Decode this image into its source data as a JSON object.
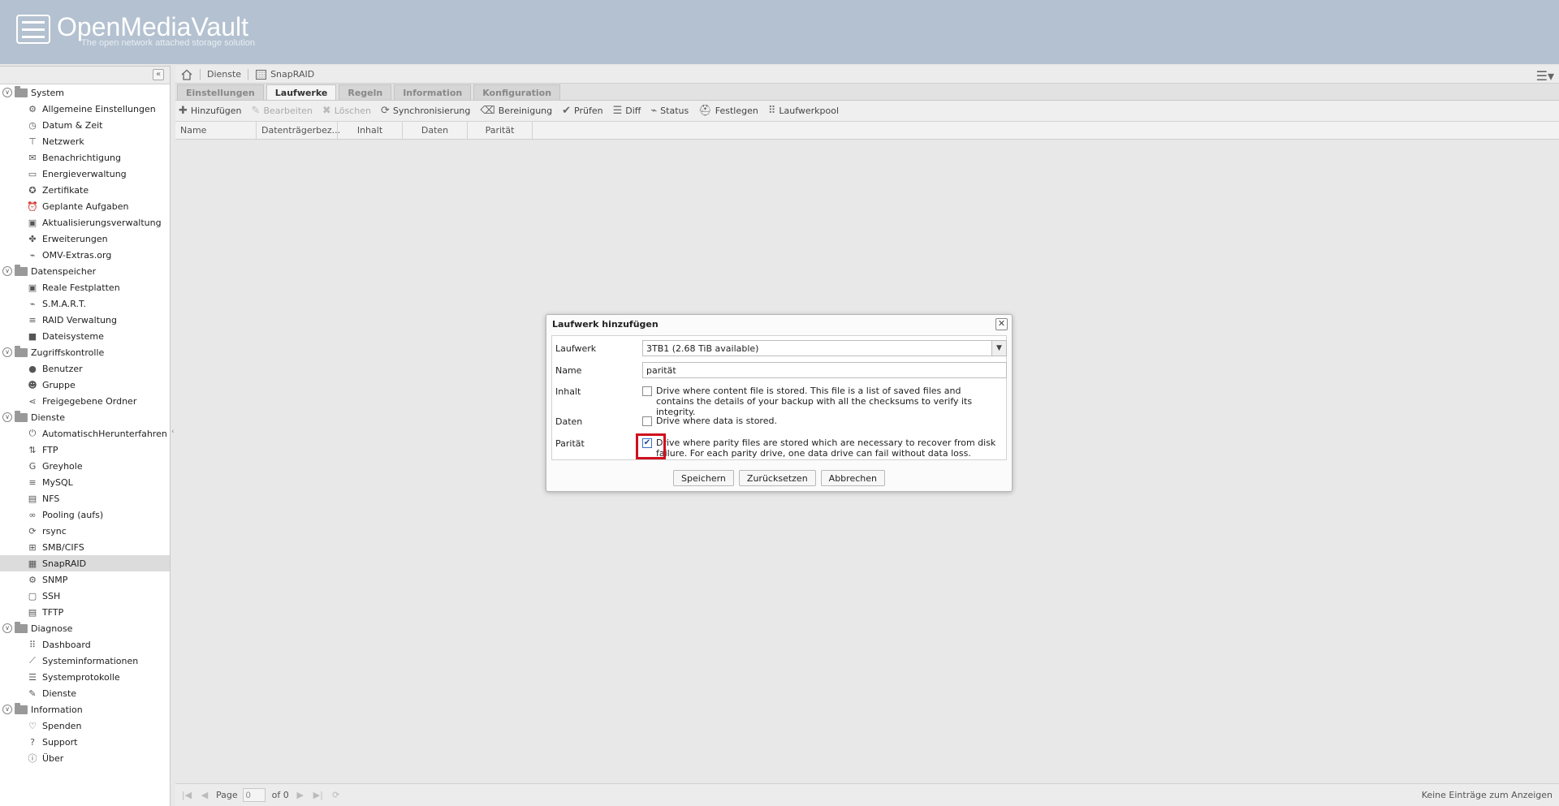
{
  "header": {
    "title": "OpenMediaVault",
    "subtitle": "The open network attached storage solution"
  },
  "sidebar": {
    "collapse_label": "«",
    "tree": [
      {
        "label": "System",
        "type": "group",
        "icon": "folder-icon"
      },
      {
        "label": "Allgemeine Einstellungen",
        "type": "leaf",
        "icon": "gears-icon"
      },
      {
        "label": "Datum & Zeit",
        "type": "leaf",
        "icon": "clock-icon"
      },
      {
        "label": "Netzwerk",
        "type": "leaf",
        "icon": "network-icon"
      },
      {
        "label": "Benachrichtigung",
        "type": "leaf",
        "icon": "envelope-icon"
      },
      {
        "label": "Energieverwaltung",
        "type": "leaf",
        "icon": "battery-icon"
      },
      {
        "label": "Zertifikate",
        "type": "leaf",
        "icon": "certificate-icon"
      },
      {
        "label": "Geplante Aufgaben",
        "type": "leaf",
        "icon": "alarm-clock-icon"
      },
      {
        "label": "Aktualisierungsverwaltung",
        "type": "leaf",
        "icon": "update-icon"
      },
      {
        "label": "Erweiterungen",
        "type": "leaf",
        "icon": "puzzle-icon"
      },
      {
        "label": "OMV-Extras.org",
        "type": "leaf",
        "icon": "plug-icon"
      },
      {
        "label": "Datenspeicher",
        "type": "group",
        "icon": "folder-icon"
      },
      {
        "label": "Reale Festplatten",
        "type": "leaf",
        "icon": "hdd-icon"
      },
      {
        "label": "S.M.A.R.T.",
        "type": "leaf",
        "icon": "pulse-icon"
      },
      {
        "label": "RAID Verwaltung",
        "type": "leaf",
        "icon": "database-icon"
      },
      {
        "label": "Dateisysteme",
        "type": "leaf",
        "icon": "folder-closed-icon"
      },
      {
        "label": "Zugriffskontrolle",
        "type": "group",
        "icon": "folder-icon"
      },
      {
        "label": "Benutzer",
        "type": "leaf",
        "icon": "user-icon"
      },
      {
        "label": "Gruppe",
        "type": "leaf",
        "icon": "users-icon"
      },
      {
        "label": "Freigegebene Ordner",
        "type": "leaf",
        "icon": "share-icon"
      },
      {
        "label": "Dienste",
        "type": "group",
        "icon": "folder-icon"
      },
      {
        "label": "AutomatischHerunterfahren",
        "type": "leaf",
        "icon": "power-icon"
      },
      {
        "label": "FTP",
        "type": "leaf",
        "icon": "ftp-icon"
      },
      {
        "label": "Greyhole",
        "type": "leaf",
        "icon": "greyhole-icon"
      },
      {
        "label": "MySQL",
        "type": "leaf",
        "icon": "database-icon"
      },
      {
        "label": "NFS",
        "type": "leaf",
        "icon": "file-icon"
      },
      {
        "label": "Pooling (aufs)",
        "type": "leaf",
        "icon": "link-icon"
      },
      {
        "label": "rsync",
        "type": "leaf",
        "icon": "sync-icon"
      },
      {
        "label": "SMB/CIFS",
        "type": "leaf",
        "icon": "windows-icon"
      },
      {
        "label": "SnapRAID",
        "type": "leaf",
        "icon": "snapraid-icon",
        "selected": true
      },
      {
        "label": "SNMP",
        "type": "leaf",
        "icon": "gears-icon"
      },
      {
        "label": "SSH",
        "type": "leaf",
        "icon": "terminal-icon"
      },
      {
        "label": "TFTP",
        "type": "leaf",
        "icon": "server-icon"
      },
      {
        "label": "Diagnose",
        "type": "group",
        "icon": "folder-icon"
      },
      {
        "label": "Dashboard",
        "type": "leaf",
        "icon": "dashboard-icon"
      },
      {
        "label": "Systeminformationen",
        "type": "leaf",
        "icon": "chart-line-icon"
      },
      {
        "label": "Systemprotokolle",
        "type": "leaf",
        "icon": "list-icon"
      },
      {
        "label": "Dienste",
        "type": "leaf",
        "icon": "wrench-icon"
      },
      {
        "label": "Information",
        "type": "group",
        "icon": "folder-icon"
      },
      {
        "label": "Spenden",
        "type": "leaf",
        "icon": "heart-icon"
      },
      {
        "label": "Support",
        "type": "leaf",
        "icon": "question-icon"
      },
      {
        "label": "Über",
        "type": "leaf",
        "icon": "info-icon"
      }
    ]
  },
  "breadcrumb": {
    "home_icon": "home-icon",
    "items": [
      "Dienste",
      "SnapRAID"
    ]
  },
  "tabs": [
    {
      "label": "Einstellungen",
      "active": false
    },
    {
      "label": "Laufwerke",
      "active": true
    },
    {
      "label": "Regeln",
      "active": false
    },
    {
      "label": "Information",
      "active": false
    },
    {
      "label": "Konfiguration",
      "active": false
    }
  ],
  "toolbar": [
    {
      "label": "Hinzufügen",
      "icon": "plus-icon",
      "enabled": true
    },
    {
      "label": "Bearbeiten",
      "icon": "edit-icon",
      "enabled": false
    },
    {
      "label": "Löschen",
      "icon": "delete-icon",
      "enabled": false
    },
    {
      "label": "Synchronisierung",
      "icon": "sync-icon",
      "enabled": true
    },
    {
      "label": "Bereinigung",
      "icon": "eraser-icon",
      "enabled": true
    },
    {
      "label": "Prüfen",
      "icon": "check-icon",
      "enabled": true
    },
    {
      "label": "Diff",
      "icon": "list-icon",
      "enabled": true
    },
    {
      "label": "Status",
      "icon": "pulse-icon",
      "enabled": true
    },
    {
      "label": "Festlegen",
      "icon": "medkit-icon",
      "enabled": true
    },
    {
      "label": "Laufwerkpool",
      "icon": "grid-icon",
      "enabled": true
    }
  ],
  "grid": {
    "columns": [
      "Name",
      "Datenträgerbez...",
      "Inhalt",
      "Daten",
      "Parität"
    ]
  },
  "pager": {
    "page_label": "Page",
    "page_value": "0",
    "of_label": "of 0",
    "status": "Keine Einträge zum Anzeigen"
  },
  "dialog": {
    "title": "Laufwerk hinzufügen",
    "fields": {
      "drive": {
        "label": "Laufwerk",
        "value": "3TB1 (2.68 TiB available)"
      },
      "name": {
        "label": "Name",
        "value": "parität"
      },
      "content": {
        "label": "Inhalt",
        "checked": false,
        "text": "Drive where content file is stored. This file is a list of saved files and contains the details of your backup with all the checksums to verify its integrity."
      },
      "data": {
        "label": "Daten",
        "checked": false,
        "text": "Drive where data is stored."
      },
      "parity": {
        "label": "Parität",
        "checked": true,
        "text": "Drive where parity files are stored which are necessary to recover from disk failure. For each parity drive, one data drive can fail without data loss."
      }
    },
    "buttons": {
      "save": "Speichern",
      "reset": "Zurücksetzen",
      "cancel": "Abbrechen"
    },
    "highlight_color": "#d0101e"
  }
}
